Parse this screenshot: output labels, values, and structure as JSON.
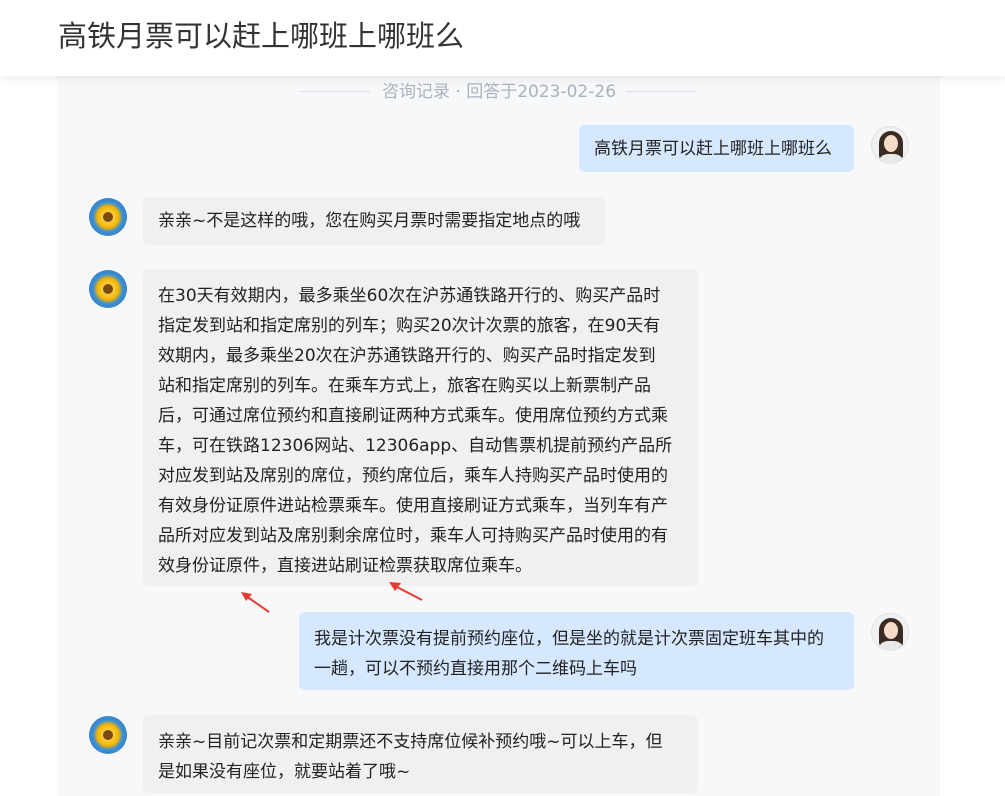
{
  "header": {
    "title": "高铁月票可以赶上哪班上哪班么"
  },
  "divider": {
    "label": "咨询记录 · 回答于2023-02-26"
  },
  "messages": [
    {
      "role": "user",
      "text": "高铁月票可以赶上哪班上哪班么"
    },
    {
      "role": "assistant",
      "text": "亲亲~不是这样的哦，您在购买月票时需要指定地点的哦"
    },
    {
      "role": "assistant",
      "lines": [
        "在30天有效期内，最多乘坐60次在沪苏通铁路开行的、购买产品时",
        "指定发到站和指定席别的列车；购买20次计次票的旅客，在90天有",
        "效期内，最多乘坐20次在沪苏通铁路开行的、购买产品时指定发到",
        "站和指定席别的列车。在乘车方式上，旅客在购买以上新票制产品",
        "后，可通过席位预约和直接刷证两种方式乘车。使用席位预约方式乘",
        "车，可在铁路12306网站、12306app、自动售票机提前预约产品所",
        "对应发到站及席别的席位，预约席位后，乘车人持购买产品时使用的",
        "有效身份证原件进站检票乘车。使用直接刷证方式乘车，当列车有产",
        "品所对应发到站及席别剩余席位时，乘车人可持购买产品时使用的有",
        "效身份证原件，直接进站刷证检票获取席位乘车。"
      ]
    },
    {
      "role": "user",
      "lines": [
        "我是计次票没有提前预约座位，但是坐的就是计次票固定班车其中的",
        "一趟，可以不预约直接用那个二维码上车吗"
      ]
    },
    {
      "role": "assistant",
      "lines": [
        "亲亲~目前记次票和定期票还不支持席位候补预约哦~可以上车，但",
        "是如果没有座位，就要站着了哦~"
      ]
    }
  ],
  "colors": {
    "user_bubble": "#d6e8ff",
    "assistant_bubble": "#f0f0f0",
    "annotation_arrow": "#e8382f",
    "divider_text": "#aab2bd"
  }
}
